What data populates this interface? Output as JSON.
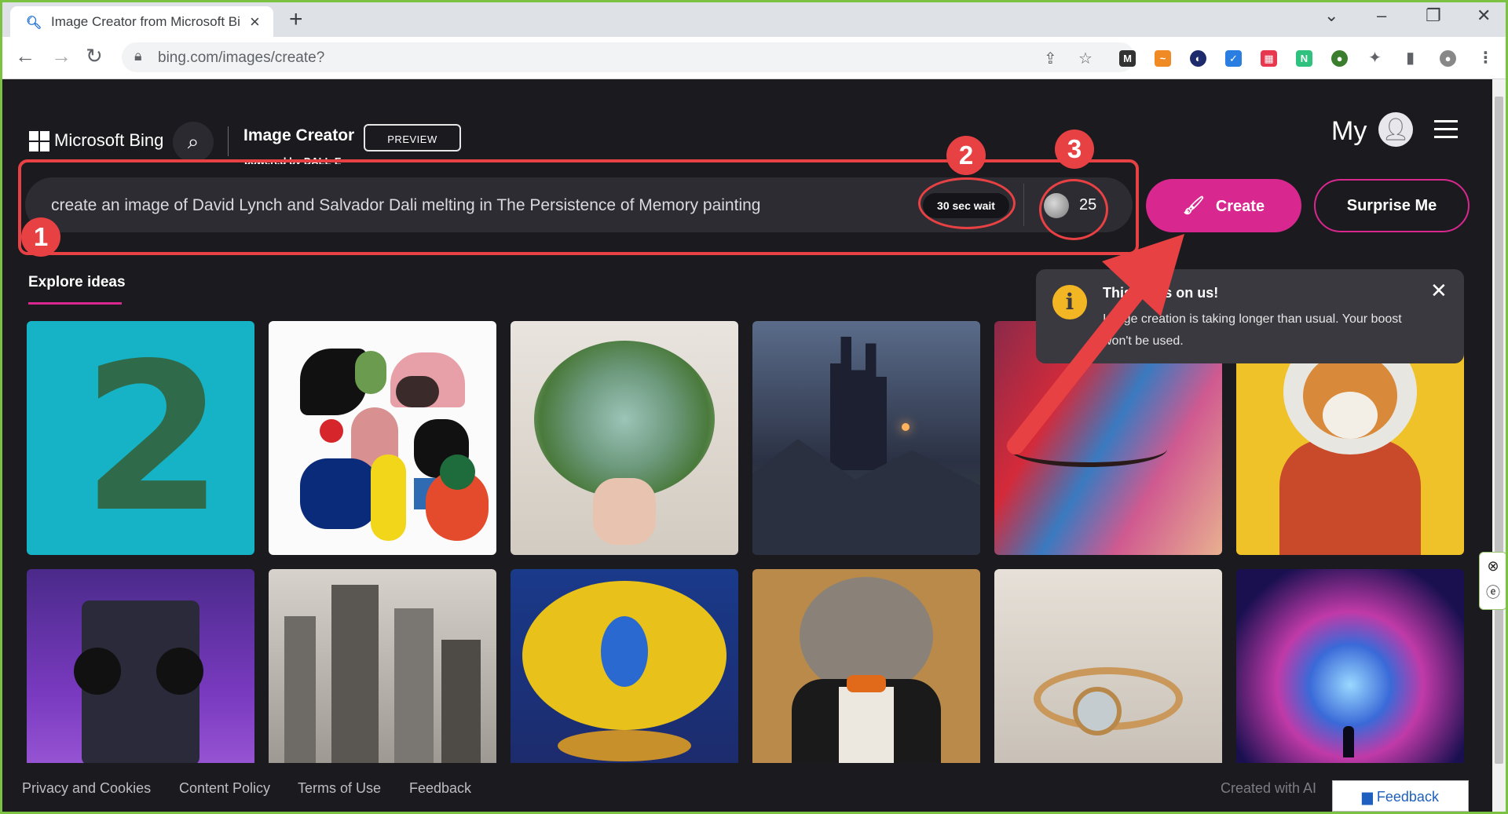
{
  "browser": {
    "tab_title": "Image Creator from Microsoft Bi",
    "url": "bing.com/images/create?"
  },
  "header": {
    "brand": "Microsoft Bing",
    "title": "Image Creator",
    "badge": "PREVIEW",
    "powered_by": "powered by DALL·E",
    "my_label": "My"
  },
  "prompt": {
    "text": "create an image of David Lynch and Salvador Dali melting in The Persistence of Memory painting",
    "wait_label": "30 sec wait",
    "boost_count": "25"
  },
  "buttons": {
    "create": "Create",
    "surprise": "Surprise Me"
  },
  "annotations": [
    "1",
    "2",
    "3"
  ],
  "explore": {
    "label": "Explore ideas"
  },
  "toast": {
    "title": "This one's on us!",
    "body": "Image creation is taking longer than usual. Your boost won't be used."
  },
  "footer": {
    "links": [
      "Privacy and Cookies",
      "Content Policy",
      "Terms of Use",
      "Feedback"
    ],
    "created_with": "Created with AI",
    "feedback_button": "Feedback"
  },
  "colors": {
    "accent": "#d8288f",
    "annotation": "#e84143",
    "toast_icon": "#f2b624",
    "background": "#1b1a1f"
  }
}
